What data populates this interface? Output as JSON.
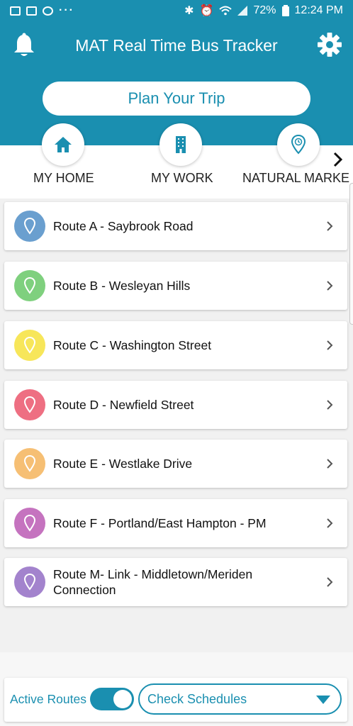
{
  "status_bar": {
    "battery": "72%",
    "time": "12:24 PM",
    "icons": [
      "gallery-icon",
      "mail-icon",
      "skype-icon",
      "more-icon",
      "bluetooth-icon",
      "alarm-icon",
      "wifi-icon",
      "signal-icon",
      "battery-icon"
    ]
  },
  "header": {
    "title": "MAT Real Time Bus Tracker",
    "left_icon": "bell-icon",
    "right_icon": "gear-icon"
  },
  "plan_trip": {
    "label": "Plan Your Trip"
  },
  "quick_links": [
    {
      "label": "MY HOME",
      "icon": "home-icon"
    },
    {
      "label": "MY WORK",
      "icon": "building-icon"
    },
    {
      "label": "NATURAL MARKET",
      "icon": "location-clock-icon"
    }
  ],
  "routes": [
    {
      "label": "Route A - Saybrook Road",
      "color": "#6a9fcf"
    },
    {
      "label": "Route B - Wesleyan Hills",
      "color": "#7fd07e"
    },
    {
      "label": "Route C - Washington Street",
      "color": "#f7e65a"
    },
    {
      "label": "Route D - Newfield Street",
      "color": "#ee6f82"
    },
    {
      "label": "Route E - Westlake Drive",
      "color": "#f6bf74"
    },
    {
      "label": "Route F - Portland/East Hampton - PM",
      "color": "#c573bf"
    },
    {
      "label": "Route M- Link - Middletown/Meriden Connection",
      "color": "#a383cd"
    }
  ],
  "bottom_bar": {
    "active_routes_label": "Active Routes",
    "active_routes_on": true,
    "schedule_select": "Check Schedules"
  },
  "colors": {
    "brand": "#1a8fb0"
  }
}
